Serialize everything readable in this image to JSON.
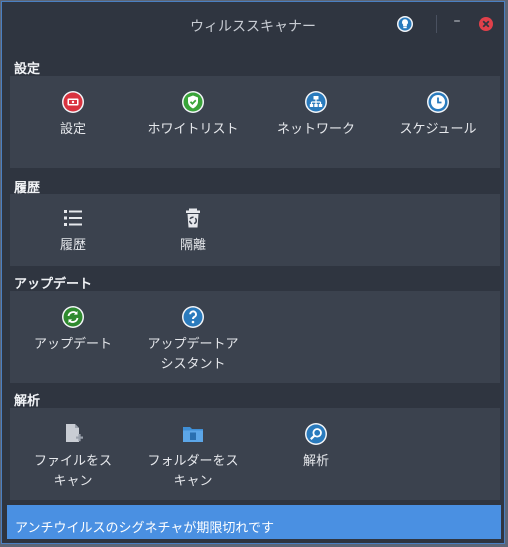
{
  "window": {
    "title": "ウィルススキャナー",
    "minimize_glyph": "–"
  },
  "sections": {
    "settings": {
      "title": "設定",
      "items": [
        {
          "label": "設定",
          "icon": "settings-card-icon"
        },
        {
          "label": "ホワイトリスト",
          "icon": "check-shield-icon"
        },
        {
          "label": "ネットワーク",
          "icon": "network-icon"
        },
        {
          "label": "スケジュール",
          "icon": "clock-icon"
        }
      ]
    },
    "history": {
      "title": "履歴",
      "items": [
        {
          "label": "履歴",
          "icon": "list-icon"
        },
        {
          "label": "隔離",
          "icon": "recycle-bin-icon"
        }
      ]
    },
    "update": {
      "title": "アップデート",
      "items": [
        {
          "label": "アップデート",
          "icon": "refresh-icon"
        },
        {
          "label": "アップデートア\nシスタント",
          "icon": "help-icon"
        }
      ]
    },
    "analysis": {
      "title": "解析",
      "items": [
        {
          "label": "ファイルをス\nキャン",
          "icon": "file-add-icon"
        },
        {
          "label": "フォルダーをス\nキャン",
          "icon": "folder-icon"
        },
        {
          "label": "解析",
          "icon": "magnifier-icon"
        }
      ]
    }
  },
  "status_bar": {
    "text": "アンチウイルスのシグネチャが期限切れです"
  },
  "colors": {
    "window_bg": "#2f3540",
    "panel_bg": "#3b424e",
    "status_bg": "#4a90e2",
    "red_icon": "#d9333f",
    "green_icon": "#3aa43a",
    "blue_icon": "#2a7bbd",
    "close_button": "#e0404a"
  }
}
